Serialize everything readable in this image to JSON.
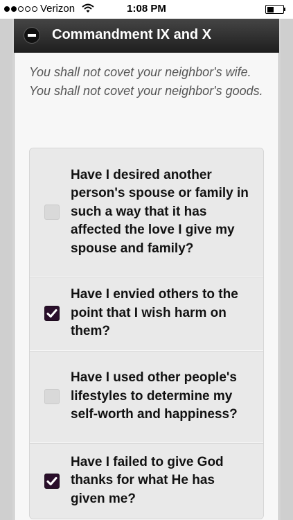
{
  "status_bar": {
    "carrier": "Verizon",
    "time": "1:08 PM",
    "signal_bars_filled": 2,
    "signal_bars_total": 5,
    "battery_level": 0.45
  },
  "section": {
    "title": "Commandment IX and X",
    "intro": [
      "You shall not covet your neighbor's wife.",
      "You shall not covet your neighbor's goods."
    ]
  },
  "questions": [
    {
      "text": "Have I desired another person's spouse or family in such a way that it has affected the love I give my spouse and family?",
      "checked": false
    },
    {
      "text": "Have I envied others to the point that I wish harm on them?",
      "checked": true
    },
    {
      "text": "Have I used other people's lifestyles to determine my self-worth and happiness?",
      "checked": false
    },
    {
      "text": "Have I failed to give God thanks for what He has given me?",
      "checked": true
    }
  ],
  "icons": {
    "collapse": "minus-circle-icon",
    "checkbox_checked": "checkmark-icon",
    "wifi": "wifi-icon",
    "battery": "battery-icon"
  },
  "colors": {
    "header": "#2c2c2c",
    "checkbox_checked": "#2a0f2b",
    "checkbox_unchecked": "#d9d9d9",
    "intro_text": "#555555"
  }
}
